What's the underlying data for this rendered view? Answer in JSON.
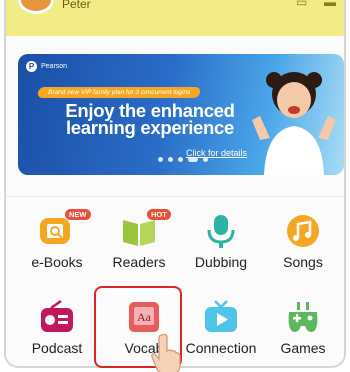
{
  "header": {
    "user_name": "Peter"
  },
  "banner": {
    "brand": "Pearson",
    "ribbon": "Brand new VIP family plan for 3 concurrent logins",
    "headline_line1": "Enjoy the enhanced",
    "headline_line2": "learning experience",
    "cta": "Click for details",
    "dots": 5,
    "active_dot": 4
  },
  "menu": {
    "items": [
      {
        "label": "e-Books",
        "icon": "ebook-icon",
        "badge": "NEW",
        "color": "#f5a623"
      },
      {
        "label": "Readers",
        "icon": "book-open-icon",
        "badge": "HOT",
        "color": "#9bc53d"
      },
      {
        "label": "Dubbing",
        "icon": "microphone-icon",
        "badge": "",
        "color": "#2bb3a3"
      },
      {
        "label": "Songs",
        "icon": "music-note-icon",
        "badge": "",
        "color": "#f5a623"
      },
      {
        "label": "Podcast",
        "icon": "radio-icon",
        "badge": "",
        "color": "#c2185b"
      },
      {
        "label": "Vocab",
        "icon": "vocab-card-icon",
        "badge": "",
        "color": "#e85c5c"
      },
      {
        "label": "Connection",
        "icon": "tv-play-icon",
        "badge": "",
        "color": "#4fc3e8"
      },
      {
        "label": "Games",
        "icon": "gamepad-icon",
        "badge": "",
        "color": "#5cb85c"
      }
    ],
    "highlighted": "Vocab"
  },
  "colors": {
    "header_bg": "#f2ec86",
    "banner_blue": "#1b4fa6",
    "highlight_red": "#d92626",
    "badge_red": "#e8503a"
  }
}
